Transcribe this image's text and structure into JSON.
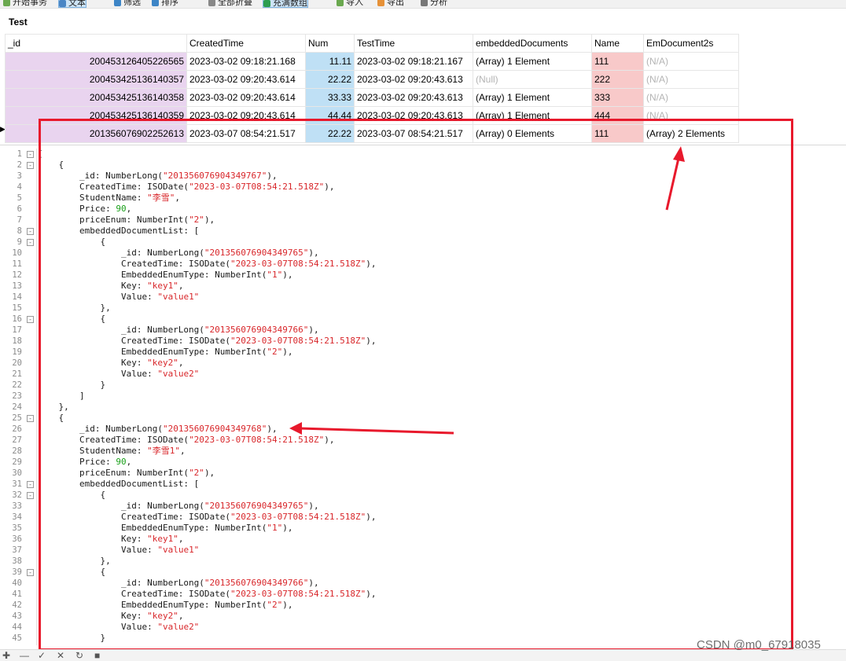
{
  "toolbar": {
    "items": [
      "开始事务",
      "文本",
      "筛选",
      "排序",
      "全部折叠",
      "充满数组",
      "导入",
      "导出",
      "分析"
    ]
  },
  "tab_title": "Test",
  "table": {
    "columns": [
      "_id",
      "CreatedTime",
      "Num",
      "TestTime",
      "embeddedDocuments",
      "Name",
      "EmDocument2s"
    ],
    "rows": [
      [
        "200453126405226565",
        "2023-03-02 09:18:21.168",
        "11.11",
        "2023-03-02 09:18:21.167",
        "(Array) 1 Element",
        "111",
        "(N/A)"
      ],
      [
        "200453425136140357",
        "2023-03-02 09:20:43.614",
        "22.22",
        "2023-03-02 09:20:43.613",
        "(Null)",
        "222",
        "(N/A)"
      ],
      [
        "200453425136140358",
        "2023-03-02 09:20:43.614",
        "33.33",
        "2023-03-02 09:20:43.613",
        "(Array) 1 Element",
        "333",
        "(N/A)"
      ],
      [
        "200453425136140359",
        "2023-03-02 09:20:43.614",
        "44.44",
        "2023-03-02 09:20:43.613",
        "(Array) 1 Element",
        "444",
        "(N/A)"
      ],
      [
        "201356076902252613",
        "2023-03-07 08:54:21.517",
        "22.22",
        "2023-03-07 08:54:21.517",
        "(Array) 0 Elements",
        "111",
        "(Array) 2 Elements"
      ]
    ]
  },
  "editor": {
    "lines": [
      {
        "n": "1",
        "fold": "-",
        "t": "["
      },
      {
        "n": "2",
        "fold": "-",
        "t": "    {"
      },
      {
        "n": "3",
        "fold": "",
        "t": "        _id: NumberLong(\"201356076904349767\"),"
      },
      {
        "n": "4",
        "fold": "",
        "t": "        CreatedTime: ISODate(\"2023-03-07T08:54:21.518Z\"),"
      },
      {
        "n": "5",
        "fold": "",
        "t": "        StudentName: \"李雪\","
      },
      {
        "n": "6",
        "fold": "",
        "t": "        Price: 90,"
      },
      {
        "n": "7",
        "fold": "",
        "t": "        priceEnum: NumberInt(\"2\"),"
      },
      {
        "n": "8",
        "fold": "-",
        "t": "        embeddedDocumentList: ["
      },
      {
        "n": "9",
        "fold": "-",
        "t": "            {"
      },
      {
        "n": "10",
        "fold": "",
        "t": "                _id: NumberLong(\"201356076904349765\"),"
      },
      {
        "n": "11",
        "fold": "",
        "t": "                CreatedTime: ISODate(\"2023-03-07T08:54:21.518Z\"),"
      },
      {
        "n": "12",
        "fold": "",
        "t": "                EmbeddedEnumType: NumberInt(\"1\"),"
      },
      {
        "n": "13",
        "fold": "",
        "t": "                Key: \"key1\","
      },
      {
        "n": "14",
        "fold": "",
        "t": "                Value: \"value1\""
      },
      {
        "n": "15",
        "fold": "",
        "t": "            },"
      },
      {
        "n": "16",
        "fold": "-",
        "t": "            {"
      },
      {
        "n": "17",
        "fold": "",
        "t": "                _id: NumberLong(\"201356076904349766\"),"
      },
      {
        "n": "18",
        "fold": "",
        "t": "                CreatedTime: ISODate(\"2023-03-07T08:54:21.518Z\"),"
      },
      {
        "n": "19",
        "fold": "",
        "t": "                EmbeddedEnumType: NumberInt(\"2\"),"
      },
      {
        "n": "20",
        "fold": "",
        "t": "                Key: \"key2\","
      },
      {
        "n": "21",
        "fold": "",
        "t": "                Value: \"value2\""
      },
      {
        "n": "22",
        "fold": "",
        "t": "            }"
      },
      {
        "n": "23",
        "fold": "",
        "t": "        ]"
      },
      {
        "n": "24",
        "fold": "",
        "t": "    },"
      },
      {
        "n": "25",
        "fold": "-",
        "t": "    {"
      },
      {
        "n": "26",
        "fold": "",
        "t": "        _id: NumberLong(\"201356076904349768\"),"
      },
      {
        "n": "27",
        "fold": "",
        "t": "        CreatedTime: ISODate(\"2023-03-07T08:54:21.518Z\"),"
      },
      {
        "n": "28",
        "fold": "",
        "t": "        StudentName: \"李雪1\","
      },
      {
        "n": "29",
        "fold": "",
        "t": "        Price: 90,"
      },
      {
        "n": "30",
        "fold": "",
        "t": "        priceEnum: NumberInt(\"2\"),"
      },
      {
        "n": "31",
        "fold": "-",
        "t": "        embeddedDocumentList: ["
      },
      {
        "n": "32",
        "fold": "-",
        "t": "            {"
      },
      {
        "n": "33",
        "fold": "",
        "t": "                _id: NumberLong(\"201356076904349765\"),"
      },
      {
        "n": "34",
        "fold": "",
        "t": "                CreatedTime: ISODate(\"2023-03-07T08:54:21.518Z\"),"
      },
      {
        "n": "35",
        "fold": "",
        "t": "                EmbeddedEnumType: NumberInt(\"1\"),"
      },
      {
        "n": "36",
        "fold": "",
        "t": "                Key: \"key1\","
      },
      {
        "n": "37",
        "fold": "",
        "t": "                Value: \"value1\""
      },
      {
        "n": "38",
        "fold": "",
        "t": "            },"
      },
      {
        "n": "39",
        "fold": "-",
        "t": "            {"
      },
      {
        "n": "40",
        "fold": "",
        "t": "                _id: NumberLong(\"201356076904349766\"),"
      },
      {
        "n": "41",
        "fold": "",
        "t": "                CreatedTime: ISODate(\"2023-03-07T08:54:21.518Z\"),"
      },
      {
        "n": "42",
        "fold": "",
        "t": "                EmbeddedEnumType: NumberInt(\"2\"),"
      },
      {
        "n": "43",
        "fold": "",
        "t": "                Key: \"key2\","
      },
      {
        "n": "44",
        "fold": "",
        "t": "                Value: \"value2\""
      },
      {
        "n": "45",
        "fold": "",
        "t": "            }"
      }
    ]
  },
  "watermark": "CSDN @m0_67918035",
  "colors": {
    "annotation_red": "#e8192c",
    "id_cell": "#e9d4ef",
    "num_cell": "#bfe0f5",
    "name_cell": "#f8c9c9",
    "string_literal": "#d8262a",
    "number_literal": "#1aa01a"
  },
  "bottom_icons": [
    "add-icon",
    "remove-icon",
    "check-icon",
    "cancel-icon",
    "refresh-icon",
    "stop-icon"
  ]
}
